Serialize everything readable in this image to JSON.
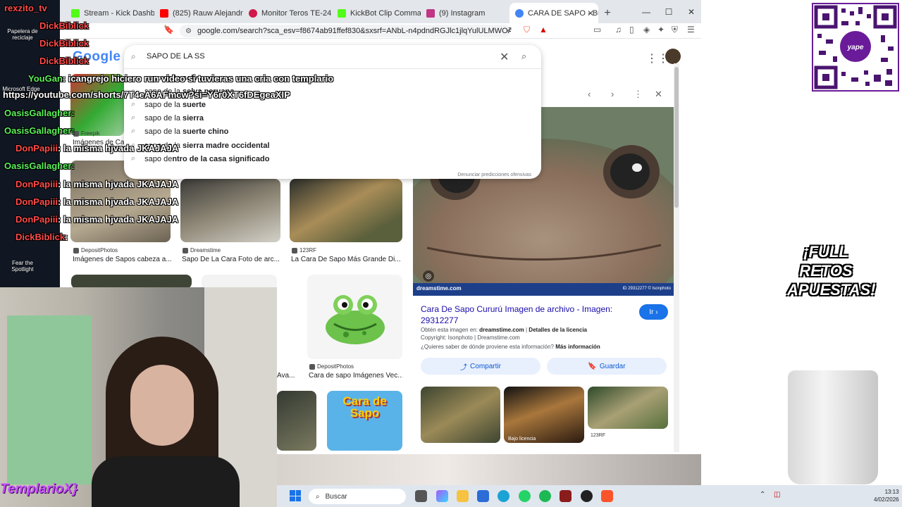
{
  "browser": {
    "tabs": [
      {
        "label": "Stream - Kick Dashboa",
        "color": "#53fc18"
      },
      {
        "label": "(825) Rauw Alejandro,",
        "color": "#ff0000"
      },
      {
        "label": "Monitor Teros TE-24155 p",
        "color": "#d11a4b"
      },
      {
        "label": "KickBot Clip Command",
        "color": "#53fc18"
      },
      {
        "label": "(9) Instagram",
        "color": "#c13584"
      },
      {
        "label": "CARA DE SAPO - Busc",
        "color": "#4285f4"
      }
    ],
    "url": "google.com/search?sca_esv=f8674ab91ffef830&sxsrf=ANbL-n4pdndRGJlc1jlqYulULMWOA_GiZg:17702..."
  },
  "google": {
    "logo": "Google",
    "search_value": "SAPO DE LA SS",
    "suggestions": [
      {
        "plain": "sapo de la ",
        "bold": "selva"
      },
      {
        "plain": "sapo de la ",
        "bold": "selva peruana"
      },
      {
        "plain": "sapo de la ",
        "bold": "suerte"
      },
      {
        "plain": "sapo de la ",
        "bold": "sierra"
      },
      {
        "plain": "sapo de la ",
        "bold": "suerte chino"
      },
      {
        "plain": "sapo de la ",
        "bold": "sierra madre occidental"
      },
      {
        "plain": "sapo de",
        "bold": "ntro de la casa significado"
      }
    ],
    "report_link": "Denunciar predicciones ofensivas"
  },
  "results": {
    "left_top_source": "Freepik",
    "left_top_caption": "Imágenes de Cara...",
    "row2": [
      {
        "source": "DepositPhotos",
        "caption": "Imágenes de Sapos cabeza a..."
      },
      {
        "source": "Dreamstime",
        "caption": "Sapo De La Cara Foto de arc..."
      },
      {
        "source": "123RF",
        "caption": "La Cara De Sapo Más Grande Di..."
      }
    ],
    "row3": [
      {
        "source": "DepositPhotos",
        "caption": "Cara de sapo Imágenes Vec..."
      },
      {
        "partial_caption": "Ava..."
      }
    ],
    "cartoon_text": "Cara de Sapo"
  },
  "preview": {
    "watermark": "dreamstime.com",
    "id_text": "ID 29312277 © Isonphoto",
    "title": "Cara De Sapo Cururú Imagen de archivo - Imagen: 29312277",
    "go_button": "Ir",
    "obtained_label": "Obtén esta imagen en: ",
    "obtained_site": "dreamstime.com",
    "license_sep": " | ",
    "license_link": "Detalles de la licencia",
    "copyright": "Copyright: Isonphoto | Dreamstime.com",
    "origin_question": "¿Quieres saber de dónde proviene esta información? ",
    "more_info": "Más información",
    "share": "Compartir",
    "save": "Guardar",
    "thumb_license": "Bajo licencia",
    "thumb_source": "123RF"
  },
  "chat": [
    {
      "name": "rexzito_tv",
      "text": ""
    },
    {
      "name": "DickBiblick",
      "text": ""
    },
    {
      "name": "DickBiblick",
      "text": ""
    },
    {
      "name": "DickBiblick",
      "text": ""
    },
    {
      "name": "YouGan",
      "text": ": icangrejo hiciero run video si tuvieras una cria con templario"
    },
    {
      "name": "",
      "text": "https://youtube.com/shorts/7T4eA6AFmcw?si=Y6r0XT6fDEgeaXIP"
    },
    {
      "name": "OasisGallagher",
      "text": ":"
    },
    {
      "name": "OasisGallagher",
      "text": ":"
    },
    {
      "name": "DonPapiii",
      "text": ": la misma hjvada JKAJAJA"
    },
    {
      "name": "OasisGallagher",
      "text": ":"
    },
    {
      "name": "DonPapiii",
      "text": ": la misma hjvada JKAJAJA"
    },
    {
      "name": "DonPapiii",
      "text": ": la misma hjvada JKAJAJA"
    },
    {
      "name": "DonPapiii",
      "text": ": la misma hjvada JKAJAJA"
    },
    {
      "name": "DickBiblick",
      "text": ":"
    }
  ],
  "desktop": {
    "icons": [
      "Papelera de reciclaje",
      "Microsoft Edge",
      "Fear the Spotlight"
    ],
    "webcam_name": "TemplarioX}",
    "promo": "¡FULL RETOS APUESTAS!"
  },
  "taskbar": {
    "search": "Buscar",
    "time": "13:13",
    "date": "4/02/2026"
  }
}
